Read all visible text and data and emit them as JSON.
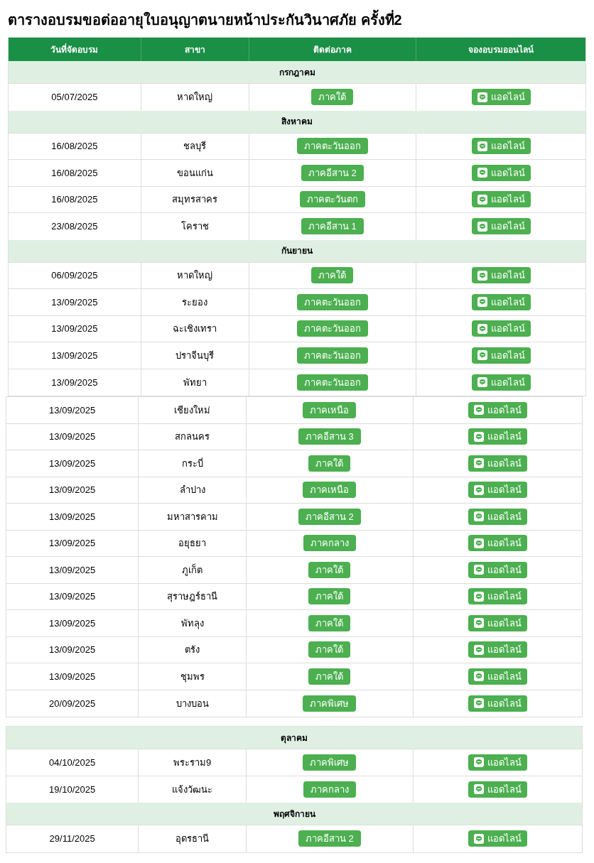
{
  "title": "ตารางอบรมขอต่ออายุใบอนุญาตนายหน้าประกันวินาศภัย ครั้งที่2",
  "columns": [
    "วันที่จัดอบรม",
    "สาขา",
    "ติดต่อภาค",
    "จองอบรมออนไลน์"
  ],
  "blocks": [
    {
      "sections": [
        {
          "month": "กรกฎาคม",
          "rows": [
            {
              "date": "05/07/2025",
              "branch": "หาดใหญ่",
              "region": "ภาคใต้",
              "book": "แอดไลน์"
            }
          ]
        },
        {
          "month": "สิงหาคม",
          "rows": [
            {
              "date": "16/08/2025",
              "branch": "ชลบุรี",
              "region": "ภาคตะวันออก",
              "book": "แอดไลน์"
            },
            {
              "date": "16/08/2025",
              "branch": "ขอนแก่น",
              "region": "ภาคอีสาน 2",
              "book": "แอดไลน์"
            },
            {
              "date": "16/08/2025",
              "branch": "สมุทรสาคร",
              "region": "ภาคตะวันตก",
              "book": "แอดไลน์"
            },
            {
              "date": "23/08/2025",
              "branch": "โคราช",
              "region": "ภาคอีสาน 1",
              "book": "แอดไลน์"
            }
          ]
        },
        {
          "month": "กันยายน",
          "rows": [
            {
              "date": "06/09/2025",
              "branch": "หาดใหญ่",
              "region": "ภาคใต้",
              "book": "แอดไลน์"
            },
            {
              "date": "13/09/2025",
              "branch": "ระยอง",
              "region": "ภาคตะวันออก",
              "book": "แอดไลน์"
            },
            {
              "date": "13/09/2025",
              "branch": "ฉะเชิงเทรา",
              "region": "ภาคตะวันออก",
              "book": "แอดไลน์"
            },
            {
              "date": "13/09/2025",
              "branch": "ปราจีนบุรี",
              "region": "ภาคตะวันออก",
              "book": "แอดไลน์"
            },
            {
              "date": "13/09/2025",
              "branch": "พัทยา",
              "region": "ภาคตะวันออก",
              "book": "แอดไลน์"
            }
          ]
        }
      ]
    },
    {
      "sections": [
        {
          "rows": [
            {
              "date": "13/09/2025",
              "branch": "เชียงใหม่",
              "region": "ภาคเหนือ",
              "book": "แอดไลน์"
            },
            {
              "date": "13/09/2025",
              "branch": "สกลนคร",
              "region": "ภาคอีสาน 3",
              "book": "แอดไลน์"
            },
            {
              "date": "13/09/2025",
              "branch": "กระบี่",
              "region": "ภาคใต้",
              "book": "แอดไลน์"
            },
            {
              "date": "13/09/2025",
              "branch": "ลำปาง",
              "region": "ภาคเหนือ",
              "book": "แอดไลน์"
            },
            {
              "date": "13/09/2025",
              "branch": "มหาสารคาม",
              "region": "ภาคอีสาน 2",
              "book": "แอดไลน์"
            },
            {
              "date": "13/09/2025",
              "branch": "อยุธยา",
              "region": "ภาคกลาง",
              "book": "แอดไลน์"
            },
            {
              "date": "13/09/2025",
              "branch": "ภูเก็ต",
              "region": "ภาคใต้",
              "book": "แอดไลน์"
            },
            {
              "date": "13/09/2025",
              "branch": "สุราษฎร์ธานี",
              "region": "ภาคใต้",
              "book": "แอดไลน์"
            },
            {
              "date": "13/09/2025",
              "branch": "พัทลุง",
              "region": "ภาคใต้",
              "book": "แอดไลน์"
            },
            {
              "date": "13/09/2025",
              "branch": "ตรัง",
              "region": "ภาคใต้",
              "book": "แอดไลน์"
            },
            {
              "date": "13/09/2025",
              "branch": "ชุมพร",
              "region": "ภาคใต้",
              "book": "แอดไลน์"
            },
            {
              "date": "20/09/2025",
              "branch": "บางบอน",
              "region": "ภาคพิเศษ",
              "book": "แอดไลน์"
            }
          ]
        }
      ]
    },
    {
      "sections": [
        {
          "month": "ตุลาคม",
          "rows": [
            {
              "date": "04/10/2025",
              "branch": "พระราม9",
              "region": "ภาคพิเศษ",
              "book": "แอดไลน์"
            },
            {
              "date": "19/10/2025",
              "branch": "แจ้งวัฒนะ",
              "region": "ภาคกลาง",
              "book": "แอดไลน์"
            }
          ]
        },
        {
          "month": "พฤศจิกายน",
          "rows": [
            {
              "date": "29/11/2025",
              "branch": "อุดรธานี",
              "region": "ภาคอีสาน 2",
              "book": "แอดไลน์"
            }
          ]
        }
      ]
    }
  ]
}
